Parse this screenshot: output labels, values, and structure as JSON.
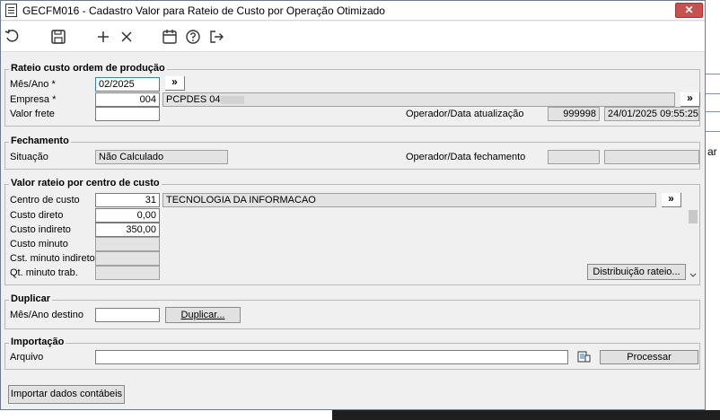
{
  "window": {
    "title": "GECFM016 - Cadastro Valor para Rateio de Custo por Operação Otimizado",
    "close_glyph": "✕"
  },
  "toolbar": {
    "icons": [
      "refresh-icon",
      "save-icon",
      "add-icon",
      "delete-icon",
      "calendar-icon",
      "help-icon",
      "exit-icon"
    ]
  },
  "rateio": {
    "title": "Rateio custo ordem de produção",
    "mes_ano_label": "Mês/Ano *",
    "mes_ano_value": "02/2025",
    "empresa_label": "Empresa *",
    "empresa_code": "004",
    "empresa_name": "PCPDES 04",
    "valor_frete_label": "Valor frete",
    "valor_frete_value": "",
    "operador_label": "Operador/Data atualização",
    "operador_value": "999998",
    "data_value": "24/01/2025 09:55:25",
    "lookup_glyph": "»"
  },
  "fechamento": {
    "title": "Fechamento",
    "situacao_label": "Situação",
    "situacao_value": "Não Calculado",
    "operador_label": "Operador/Data fechamento",
    "operador_value": "",
    "data_value": ""
  },
  "valor_rateio": {
    "title": "Valor rateio por centro de custo",
    "centro_label": "Centro de custo",
    "centro_code": "31",
    "centro_name": "TECNOLOGIA DA INFORMACAO",
    "custo_direto_label": "Custo direto",
    "custo_direto_value": "0,00",
    "custo_indireto_label": "Custo indireto",
    "custo_indireto_value": "350,00",
    "custo_minuto_label": "Custo minuto",
    "cst_minuto_label": "Cst. minuto indireto",
    "qt_minuto_label": "Qt. minuto trab.",
    "distribuicao_label": "Distribuição rateio..."
  },
  "duplicar": {
    "title": "Duplicar",
    "mes_ano_destino_label": "Mês/Ano destino",
    "mes_ano_destino_value": "",
    "duplicar_label": "Duplicar..."
  },
  "importacao": {
    "title": "Importação",
    "arquivo_label": "Arquivo",
    "arquivo_value": "",
    "processar_label": "Processar"
  },
  "footer": {
    "importar_label": "Importar dados contábeis"
  },
  "background": {
    "fragment": "ar"
  }
}
